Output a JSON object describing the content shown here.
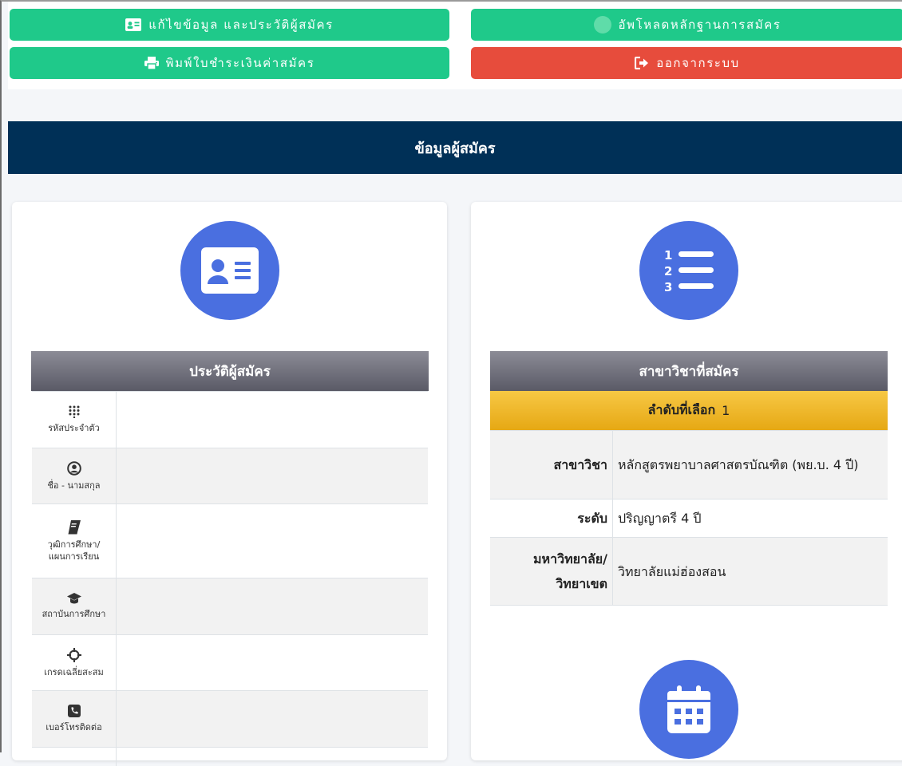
{
  "buttons": {
    "edit_profile": "แก้ไขข้อมูล และประวัติผู้สมัคร",
    "upload_evidence": "อัพโหลดหลักฐานการสมัคร",
    "print_payment": "พิมพ์ใบชำระเงินค่าสมัคร",
    "logout": "ออกจากระบบ"
  },
  "banner": {
    "title": "ข้อมูลผู้สมัคร"
  },
  "profile": {
    "icon": "id-card-icon",
    "header": "ประวัติผู้สมัคร",
    "rows": [
      {
        "icon": "keypad-icon",
        "label": "รหัสประจำตัว",
        "value": ""
      },
      {
        "icon": "user-circle-icon",
        "label": "ชื่อ - นามสกุล",
        "value": ""
      },
      {
        "icon": "book-icon",
        "label": "วุฒิการศึกษา/ แผนการเรียน",
        "value": ""
      },
      {
        "icon": "graduation-cap-icon",
        "label": "สถาบันการศึกษา",
        "value": ""
      },
      {
        "icon": "crosshairs-icon",
        "label": "เกรดเฉลี่ยสะสม",
        "value": ""
      },
      {
        "icon": "phone-icon",
        "label": "เบอร์โทรติดต่อ",
        "value": ""
      }
    ]
  },
  "program": {
    "icon": "numbered-list-icon",
    "header": "สาขาวิชาที่สมัคร",
    "choice_label": "ลำดับที่เลือก",
    "choice_number": "1",
    "rows": [
      {
        "key": "สาขาวิชา",
        "value": "หลักสูตรพยาบาลศาสตรบัณฑิต (พย.บ. 4 ปี)"
      },
      {
        "key": "ระดับ",
        "value": "ปริญญาตรี 4 ปี"
      },
      {
        "key": "มหาวิทยาลัย/ วิทยาเขต",
        "value": "วิทยาลัยแม่ฮ่องสอน"
      }
    ]
  },
  "schedule": {
    "icon": "calendar-icon"
  },
  "colors": {
    "green": "#1fc98a",
    "red": "#e74c3c",
    "navy": "#003057",
    "accent": "#4a6fe0",
    "gold": "#e6a814"
  }
}
